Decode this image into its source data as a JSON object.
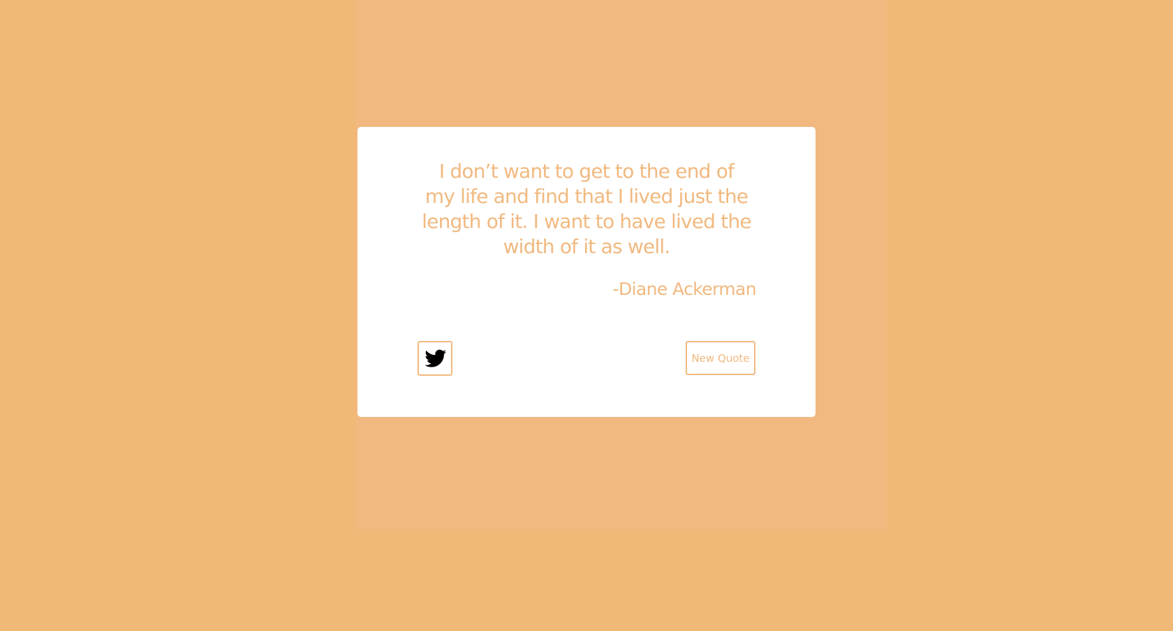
{
  "colors": {
    "page_background": "#f1b977",
    "panel_background": "#f1b980",
    "card_background": "#ffffff",
    "accent_text": "#f1b980",
    "icon": "#000000"
  },
  "quote": {
    "text": "I don’t want to get to the end of my life and find that I lived just the length of it. I want to have lived the width of it as well.",
    "author": "-Diane Ackerman"
  },
  "actions": {
    "tweet_icon": "twitter-bird-icon",
    "new_quote_label": "New Quote"
  }
}
